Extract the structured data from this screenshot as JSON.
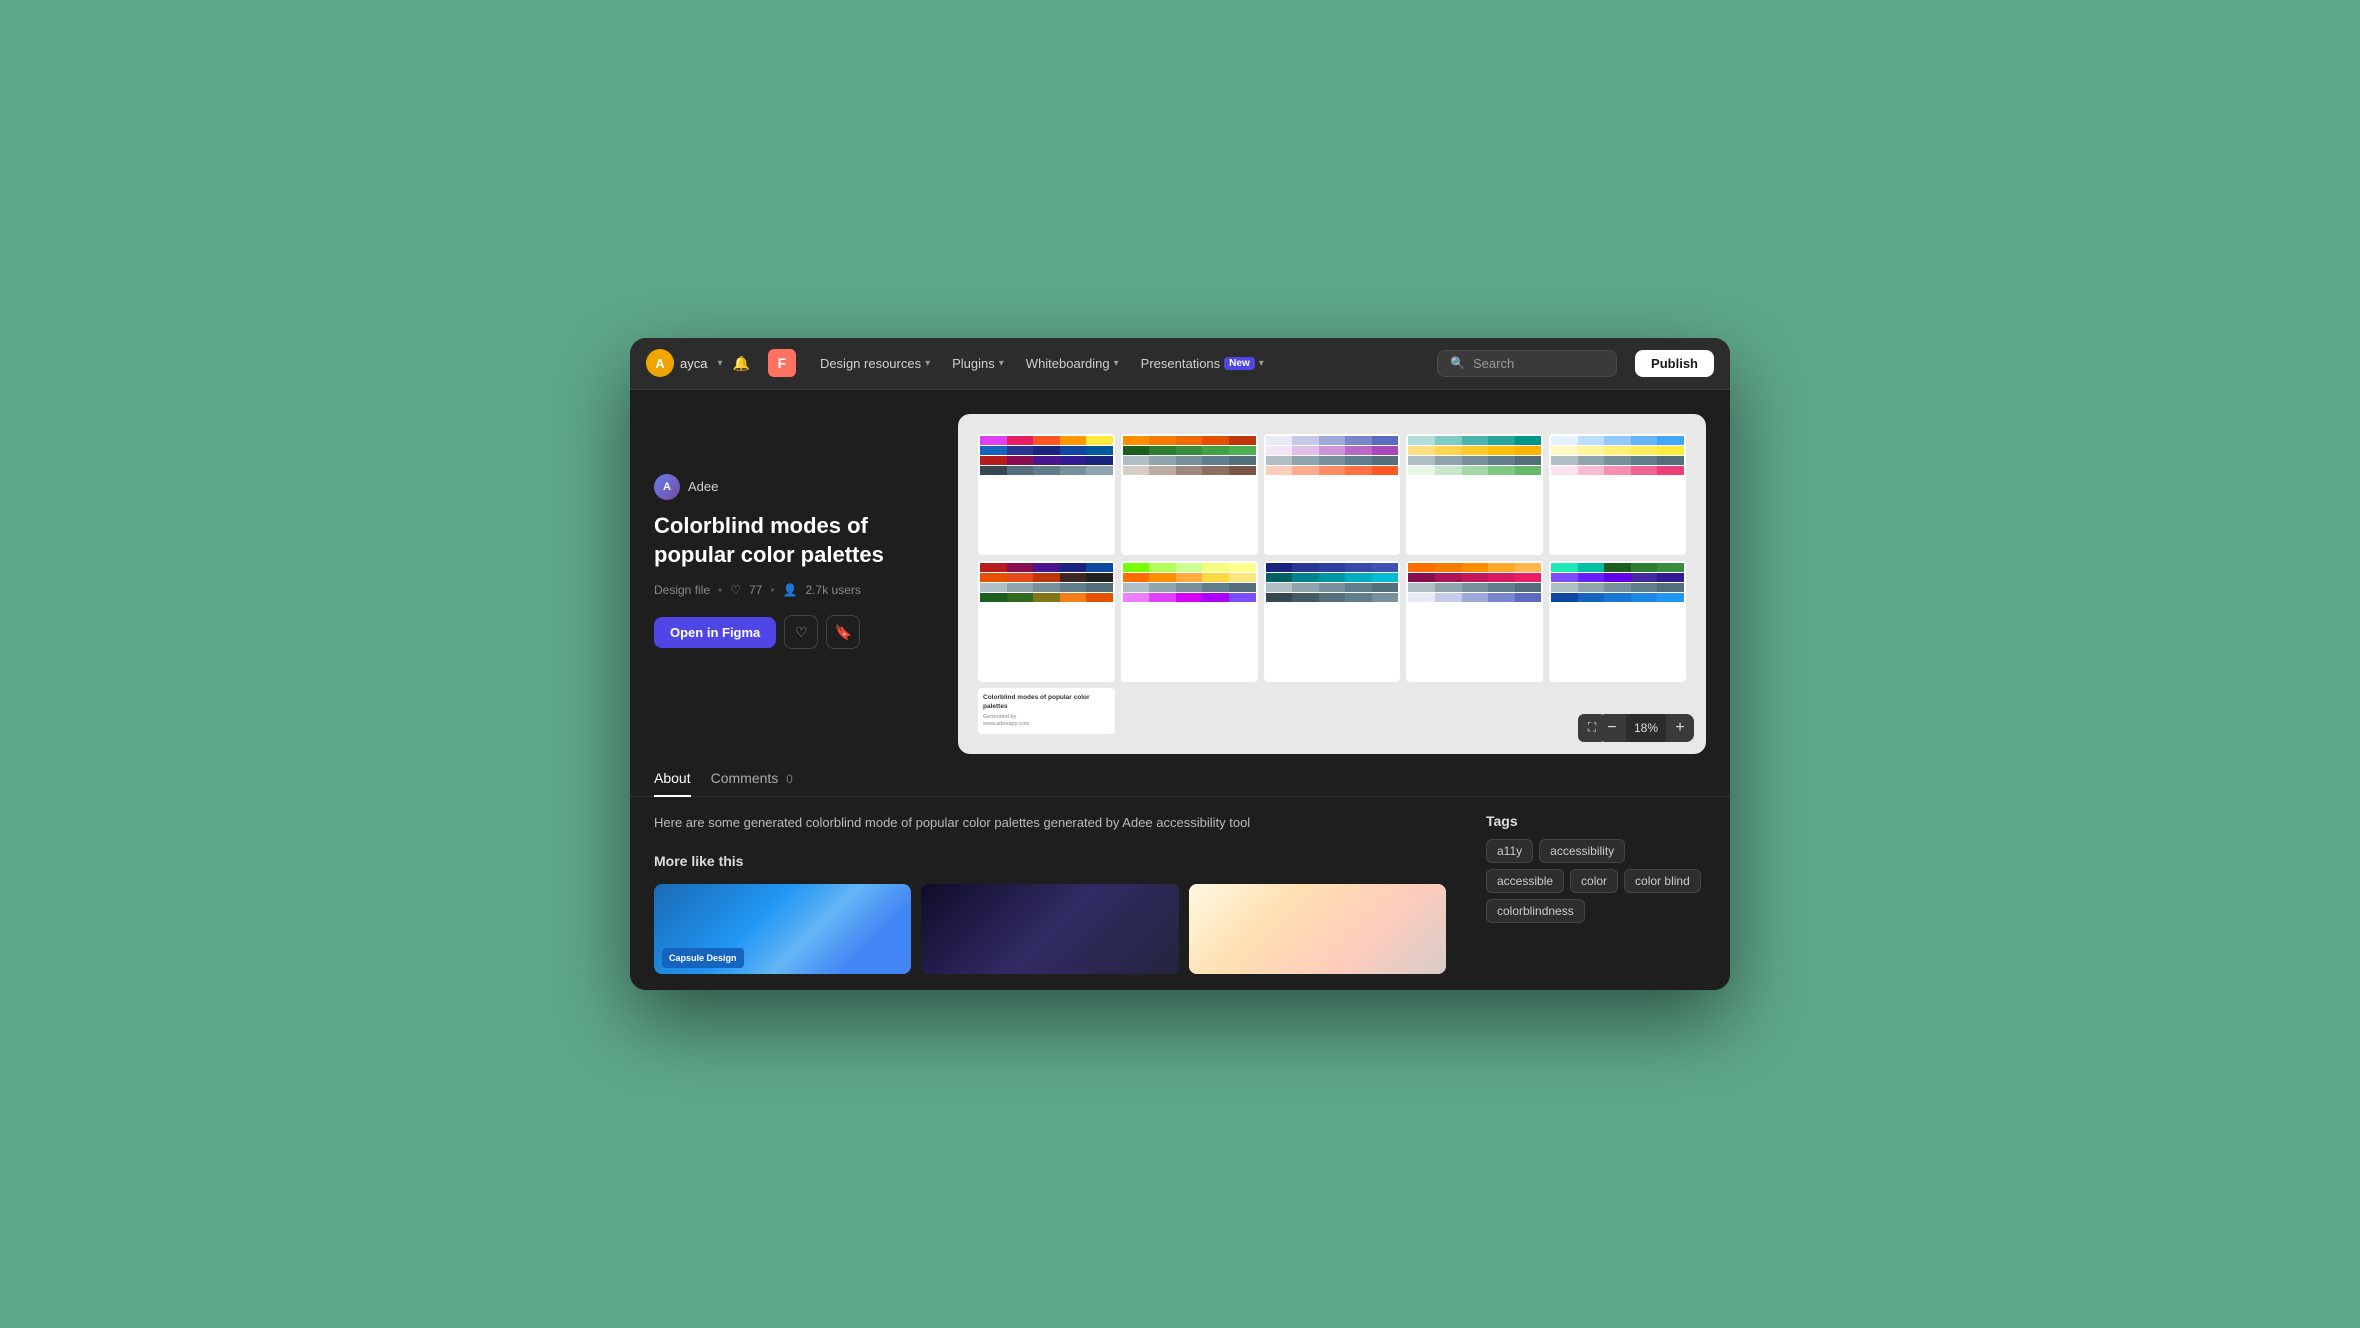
{
  "nav": {
    "avatar_letter": "A",
    "username": "ayca",
    "figma_logo": "F",
    "menu_items": [
      {
        "label": "Design resources",
        "has_dropdown": true
      },
      {
        "label": "Plugins",
        "has_dropdown": true
      },
      {
        "label": "Whiteboarding",
        "has_dropdown": true
      },
      {
        "label": "Presentations",
        "has_dropdown": true,
        "badge": "New"
      }
    ],
    "search_placeholder": "Search",
    "publish_label": "Publish"
  },
  "resource": {
    "author_initials": "A",
    "author_name": "Adee",
    "title_line1": "Colorblind modes of",
    "title_line2": "popular color palettes",
    "meta_type": "Design file",
    "meta_hearts": "77",
    "meta_users": "2.7k users",
    "open_label": "Open in Figma",
    "zoom_value": "18%"
  },
  "tabs": [
    {
      "label": "About",
      "active": true,
      "count": null
    },
    {
      "label": "Comments",
      "active": false,
      "count": "0"
    }
  ],
  "description": "Here are some generated colorblind mode of popular color palettes generated by Adee accessibility tool",
  "more_like_this": {
    "title": "More like this",
    "cards": [
      {
        "label": "Capsule Design"
      },
      {
        "label": ""
      },
      {
        "label": ""
      }
    ]
  },
  "tags": {
    "title": "Tags",
    "items": [
      "a11y",
      "accessibility",
      "accessible",
      "color",
      "color blind",
      "colorblindness"
    ]
  },
  "palettes": {
    "row1": [
      {
        "swatches": [
          [
            "#e040fb",
            "#e91e63",
            "#ff5722",
            "#ff9800",
            "#ffeb3b"
          ],
          [
            "#1565c0",
            "#283593",
            "#1a237e",
            "#0d47a1",
            "#01579b"
          ],
          [
            "#b71c1c",
            "#880e4f",
            "#4a148c",
            "#311b92",
            "#1a237e"
          ],
          [
            "#37474f",
            "#546e7a",
            "#607d8b",
            "#78909c",
            "#90a4ae"
          ]
        ]
      },
      {
        "swatches": [
          [
            "#ff8f00",
            "#f57c00",
            "#ef6c00",
            "#e65100",
            "#bf360c"
          ],
          [
            "#1b5e20",
            "#2e7d32",
            "#388e3c",
            "#43a047",
            "#4caf50"
          ],
          [
            "#b0bec5",
            "#90a4ae",
            "#78909c",
            "#607d8b",
            "#546e7a"
          ],
          [
            "#d7ccc8",
            "#bcaaa4",
            "#a1887f",
            "#8d6e63",
            "#795548"
          ]
        ]
      },
      {
        "swatches": [
          [
            "#e8eaf6",
            "#c5cae9",
            "#9fa8da",
            "#7986cb",
            "#5c6bc0"
          ],
          [
            "#f3e5f5",
            "#e1bee7",
            "#ce93d8",
            "#ba68c8",
            "#ab47bc"
          ],
          [
            "#b0bec5",
            "#90a4ae",
            "#78909c",
            "#607d8b",
            "#546e7a"
          ],
          [
            "#ffccbc",
            "#ffab91",
            "#ff8a65",
            "#ff7043",
            "#ff5722"
          ]
        ]
      },
      {
        "swatches": [
          [
            "#b2dfdb",
            "#80cbc4",
            "#4db6ac",
            "#26a69a",
            "#009688"
          ],
          [
            "#ffe082",
            "#ffd54f",
            "#ffca28",
            "#ffc107",
            "#ffb300"
          ],
          [
            "#b0bec5",
            "#90a4ae",
            "#78909c",
            "#607d8b",
            "#546e7a"
          ],
          [
            "#e8f5e9",
            "#c8e6c9",
            "#a5d6a7",
            "#81c784",
            "#66bb6a"
          ]
        ]
      },
      {
        "swatches": [
          [
            "#e3f2fd",
            "#bbdefb",
            "#90caf9",
            "#64b5f6",
            "#42a5f5"
          ],
          [
            "#fff9c4",
            "#fff59d",
            "#fff176",
            "#ffee58",
            "#ffeb3b"
          ],
          [
            "#b0bec5",
            "#90a4ae",
            "#78909c",
            "#607d8b",
            "#546e7a"
          ],
          [
            "#fce4ec",
            "#f8bbd0",
            "#f48fb1",
            "#f06292",
            "#ec407a"
          ]
        ]
      }
    ],
    "row2": [
      {
        "swatches": [
          [
            "#b71c1c",
            "#880e4f",
            "#4a148c",
            "#1a237e",
            "#0d47a1"
          ],
          [
            "#e65100",
            "#e64a19",
            "#bf360c",
            "#3e2723",
            "#212121"
          ],
          [
            "#b0bec5",
            "#90a4ae",
            "#78909c",
            "#607d8b",
            "#546e7a"
          ],
          [
            "#1b5e20",
            "#33691e",
            "#827717",
            "#f57f17",
            "#e65100"
          ]
        ]
      },
      {
        "swatches": [
          [
            "#76ff03",
            "#b2ff59",
            "#ccff90",
            "#f4ff81",
            "#ffff8d"
          ],
          [
            "#ff6d00",
            "#ff9100",
            "#ffab40",
            "#ffd740",
            "#ffe57f"
          ],
          [
            "#b0bec5",
            "#90a4ae",
            "#78909c",
            "#607d8b",
            "#546e7a"
          ],
          [
            "#ea80fc",
            "#e040fb",
            "#d500f9",
            "#aa00ff",
            "#7c4dff"
          ]
        ]
      },
      {
        "swatches": [
          [
            "#1a237e",
            "#283593",
            "#303f9f",
            "#3949ab",
            "#3f51b5"
          ],
          [
            "#006064",
            "#00838f",
            "#0097a7",
            "#00acc1",
            "#00bcd4"
          ],
          [
            "#b0bec5",
            "#90a4ae",
            "#78909c",
            "#607d8b",
            "#546e7a"
          ],
          [
            "#37474f",
            "#455a64",
            "#546e7a",
            "#607d8b",
            "#78909c"
          ]
        ]
      },
      {
        "swatches": [
          [
            "#ff6f00",
            "#f57c00",
            "#fb8c00",
            "#ffa726",
            "#ffb74d"
          ],
          [
            "#880e4f",
            "#ad1457",
            "#c2185b",
            "#d81b60",
            "#e91e63"
          ],
          [
            "#b0bec5",
            "#90a4ae",
            "#78909c",
            "#607d8b",
            "#546e7a"
          ],
          [
            "#e8eaf6",
            "#c5cae9",
            "#9fa8da",
            "#7986cb",
            "#5c6bc0"
          ]
        ]
      },
      {
        "swatches": [
          [
            "#1de9b6",
            "#00bfa5",
            "#1b5e20",
            "#2e7d32",
            "#388e3c"
          ],
          [
            "#7c4dff",
            "#651fff",
            "#6200ea",
            "#4527a0",
            "#311b92"
          ],
          [
            "#b0bec5",
            "#90a4ae",
            "#78909c",
            "#607d8b",
            "#546e7a"
          ],
          [
            "#0d47a1",
            "#1565c0",
            "#1976d2",
            "#1e88e5",
            "#2196f3"
          ]
        ]
      }
    ]
  }
}
